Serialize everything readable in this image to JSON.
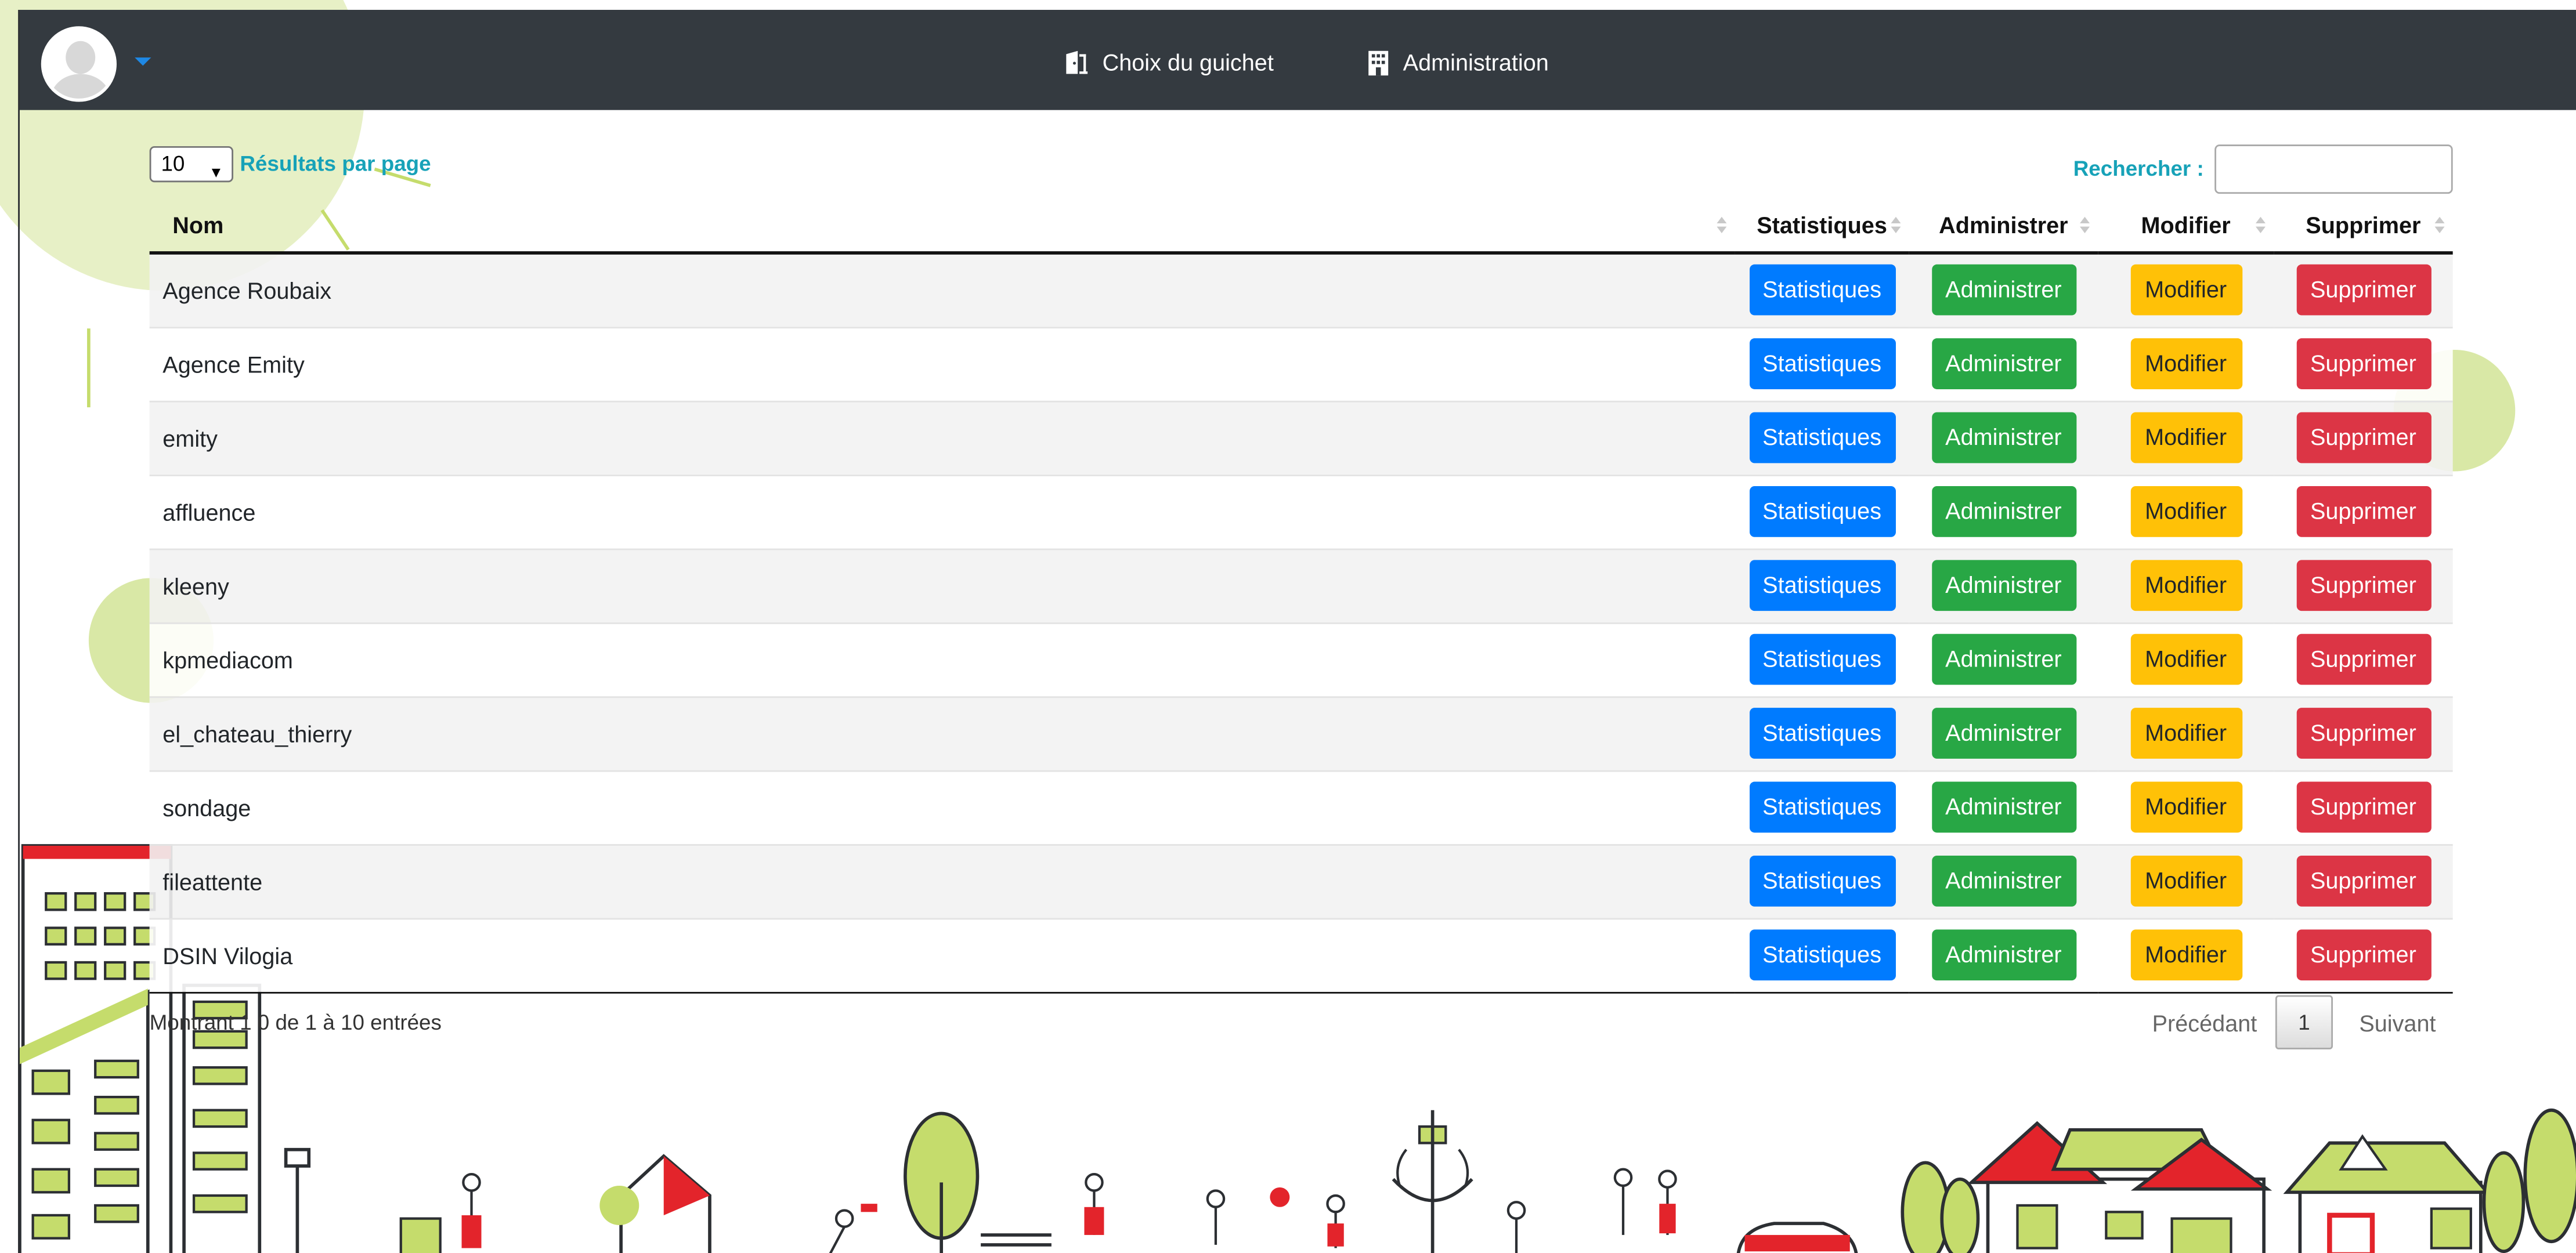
{
  "nav": {
    "left": {
      "avatar": "user-avatar",
      "caret": "chevron-down-icon"
    },
    "links": [
      {
        "label": "Choix du guichet",
        "icon": "door-icon"
      },
      {
        "label": "Administration",
        "icon": "building-icon"
      }
    ]
  },
  "controls": {
    "page_length": "10",
    "page_length_label": "Résultats par page",
    "search_label": "Rechercher :",
    "search_value": ""
  },
  "table": {
    "columns": [
      "Nom",
      "Statistiques",
      "Administrer",
      "Modifier",
      "Supprimer"
    ],
    "rows": [
      {
        "name": "Agence Roubaix"
      },
      {
        "name": "Agence Emity"
      },
      {
        "name": "emity"
      },
      {
        "name": "affluence"
      },
      {
        "name": "kleeny"
      },
      {
        "name": "kpmediacom"
      },
      {
        "name": "el_chateau_thierry"
      },
      {
        "name": "sondage"
      },
      {
        "name": "fileattente"
      },
      {
        "name": "DSIN Vilogia"
      }
    ],
    "actions": {
      "stats": "Statistiques",
      "admin": "Administrer",
      "edit": "Modifier",
      "delete": "Supprimer"
    }
  },
  "footer": {
    "info": "Montrant 1 0 de 1 à 10 entrées",
    "previous": "Précédant",
    "page": "1",
    "next": "Suivant"
  },
  "colors": {
    "navbar": "#343a40",
    "accent": "#17a2b8",
    "stats": "#007bff",
    "admin": "#28a745",
    "edit": "#ffc107",
    "delete": "#dc3545",
    "deco_green": "#c5dc6c",
    "deco_red": "#e3242b"
  }
}
